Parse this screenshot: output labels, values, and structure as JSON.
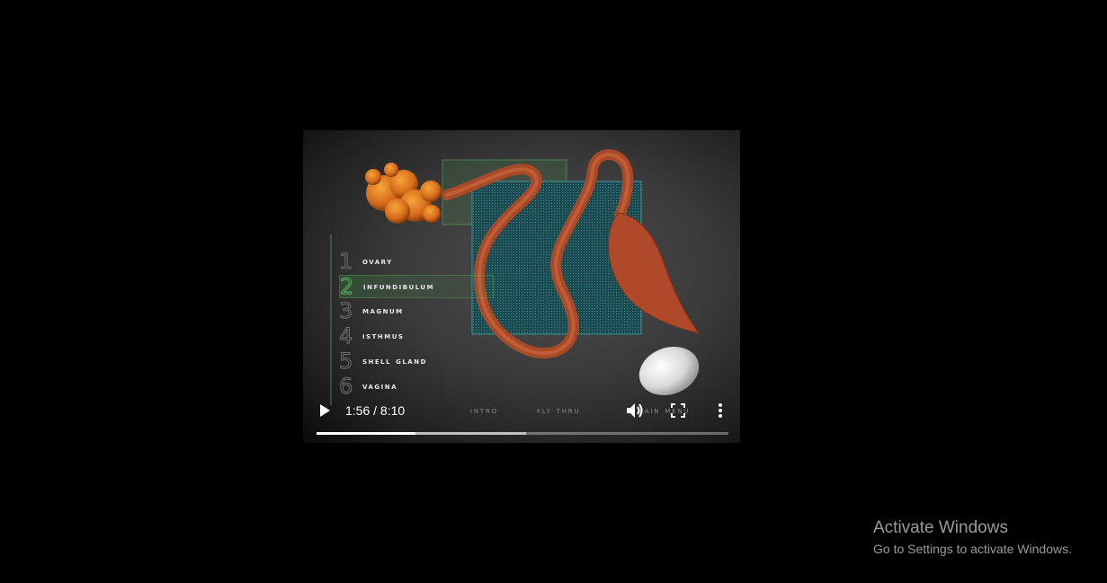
{
  "video": {
    "menu_items": [
      {
        "number": "1",
        "label": "Ovary"
      },
      {
        "number": "2",
        "label": "Infundibulum"
      },
      {
        "number": "3",
        "label": "Magnum"
      },
      {
        "number": "4",
        "label": "Isthmus"
      },
      {
        "number": "5",
        "label": "Shell Gland"
      },
      {
        "number": "6",
        "label": "Vagina"
      }
    ],
    "active_index": 1,
    "bottom_nav": {
      "intro": "Intro",
      "fly_thru": "Fly Thru",
      "main_menu": "Main Menu"
    }
  },
  "player": {
    "time_display": "1:56 / 8:10",
    "played_fraction": 0.24,
    "buffered_fraction": 0.509,
    "icons": {
      "play": "play-icon",
      "volume": "volume-icon",
      "fullscreen": "fullscreen-icon",
      "more": "more-vertical-icon"
    }
  },
  "watermark": {
    "title": "Activate Windows",
    "subtitle": "Go to Settings to activate Windows."
  },
  "colors": {
    "background": "#000000",
    "oviduct": "#b5522e",
    "ovary": "#d9731e",
    "grid_panel": "#1f5a5e",
    "highlight": "#58b85e"
  }
}
